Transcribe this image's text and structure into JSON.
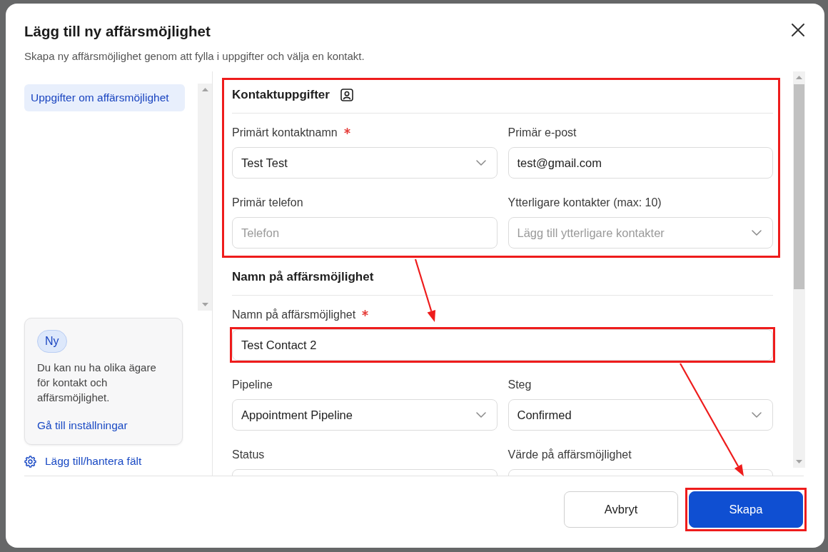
{
  "dialog": {
    "title": "Lägg till ny affärsmöjlighet",
    "subtitle": "Skapa ny affärsmöjlighet genom att fylla i uppgifter och välja en kontakt."
  },
  "sidebar": {
    "nav_items": [
      {
        "label": "Uppgifter om affärsmöjlighet",
        "selected": true
      }
    ],
    "notice": {
      "badge": "Ny",
      "text": "Du kan nu ha olika ägare för kontakt och affärsmöjlighet.",
      "link": "Gå till inställningar"
    },
    "manage_fields_link": "Lägg till/hantera fält"
  },
  "sections": [
    {
      "title": "Kontaktuppgifter",
      "title_icon": true,
      "highlighted": true,
      "rows": [
        [
          {
            "label": "Primärt kontaktnamn",
            "required": true,
            "kind": "select",
            "value": "Test Test",
            "highlighted": false
          },
          {
            "label": "Primär e-post",
            "required": false,
            "kind": "input",
            "value": "test@gmail.com",
            "highlighted": false
          }
        ],
        [
          {
            "label": "Primär telefon",
            "required": false,
            "kind": "input",
            "placeholder": "Telefon",
            "highlighted": false
          },
          {
            "label": "Ytterligare kontakter (max: 10)",
            "required": false,
            "kind": "select",
            "placeholder": "Lägg till ytterligare kontakter",
            "highlighted": false
          }
        ]
      ]
    },
    {
      "title": "Namn på affärsmöjlighet",
      "title_icon": false,
      "highlighted": false,
      "rows": [
        [
          {
            "label": "Namn på affärsmöjlighet",
            "required": true,
            "kind": "input",
            "value": "Test Contact 2",
            "highlighted": true
          }
        ],
        [
          {
            "label": "Pipeline",
            "required": false,
            "kind": "select",
            "value": "Appointment Pipeline",
            "highlighted": false
          },
          {
            "label": "Steg",
            "required": false,
            "kind": "select",
            "value": "Confirmed",
            "highlighted": false
          }
        ],
        [
          {
            "label": "Status",
            "required": false,
            "kind": "input",
            "highlighted": false
          },
          {
            "label": "Värde på affärsmöjlighet",
            "required": false,
            "kind": "input",
            "highlighted": false
          }
        ]
      ]
    }
  ],
  "buttons": [
    {
      "label": "Avbryt",
      "kind": "secondary",
      "highlighted": false
    },
    {
      "label": "Skapa",
      "kind": "primary",
      "highlighted": true
    }
  ],
  "annotations": [
    {
      "kind": "arrow"
    },
    {
      "kind": "arrow"
    }
  ]
}
